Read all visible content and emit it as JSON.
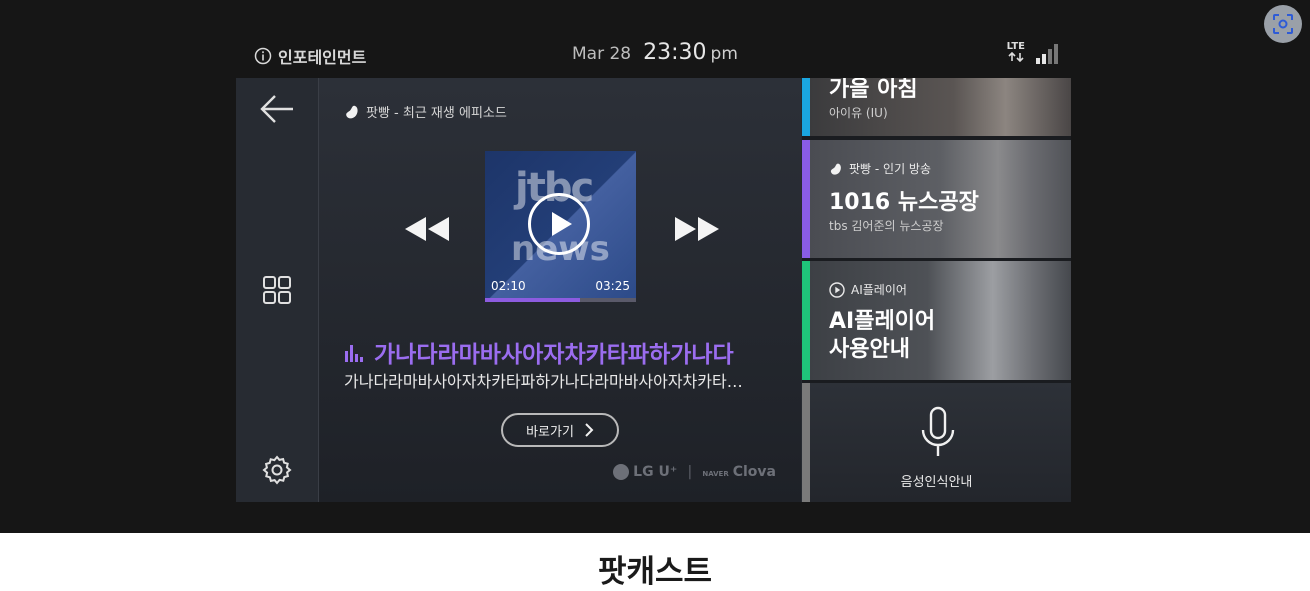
{
  "status_bar": {
    "app_label": "인포테인먼트",
    "date": "Mar 28",
    "time": "23:30",
    "ampm": "pm",
    "network": "LTE"
  },
  "player": {
    "source_label": "팟빵 - 최근 재생 에피소드",
    "artwork_text_top": "jtbc",
    "artwork_text_bottom": "news",
    "elapsed": "02:10",
    "duration": "03:25",
    "progress_fraction": 0.63,
    "title": "가나다라마바사아자차카타파하가나다",
    "subtitle": "가나다라마바사아자차카타파하가나다라마바사아자차카타…",
    "goto_label": "바로가기",
    "logo_lg": "LG U⁺",
    "logo_naver": "NAVER",
    "logo_clova": "Clova"
  },
  "cards": [
    {
      "title": "가을 아침",
      "sub": "아이유 (IU)",
      "accent": "#1aa6e0"
    },
    {
      "label": "팟빵 - 인기 방송",
      "title": "1016 뉴스공장",
      "sub": "tbs 김어준의 뉴스공장",
      "accent": "#8a5ce6"
    },
    {
      "label": "AI플레이어",
      "title_line1": "AI플레이어",
      "title_line2": "사용안내",
      "accent": "#1fc47a"
    },
    {
      "label": "음성인식안내",
      "accent": "#7a7a7a"
    }
  ],
  "caption": "팟캐스트",
  "colors": {
    "accent_purple": "#9b6df0",
    "background": "#161616"
  }
}
